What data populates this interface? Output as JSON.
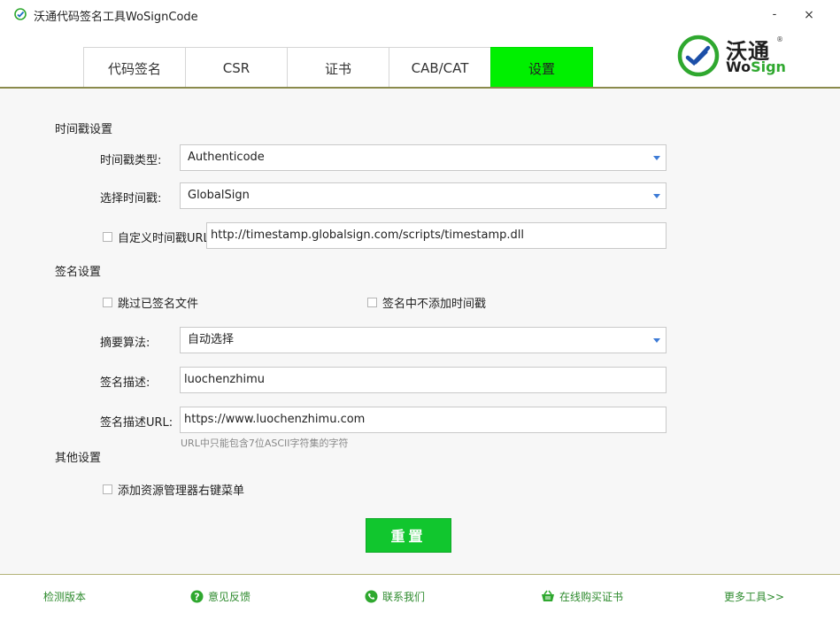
{
  "window": {
    "title": "沃通代码签名工具WoSignCode",
    "minimize_label": "-",
    "close_label": "×"
  },
  "tabs": [
    {
      "label": "代码签名",
      "active": false
    },
    {
      "label": "CSR",
      "active": false
    },
    {
      "label": "证书",
      "active": false
    },
    {
      "label": "CAB/CAT",
      "active": false
    },
    {
      "label": "设置",
      "active": true
    }
  ],
  "logo": {
    "cn": "沃通",
    "en_prefix": "Wo",
    "en_suffix": "Sign",
    "reg": "®"
  },
  "timestamp_settings": {
    "section_title": "时间戳设置",
    "type_label": "时间戳类型:",
    "type_value": "Authenticode",
    "select_label": "选择时间戳:",
    "select_value": "GlobalSign",
    "custom_url_label": "自定义时间戳URL",
    "custom_url_checked": false,
    "custom_url_value": "http://timestamp.globalsign.com/scripts/timestamp.dll"
  },
  "sign_settings": {
    "section_title": "签名设置",
    "skip_signed_label": "跳过已签名文件",
    "skip_signed_checked": false,
    "no_timestamp_label": "签名中不添加时间戳",
    "no_timestamp_checked": false,
    "digest_label": "摘要算法:",
    "digest_value": "自动选择",
    "desc_label": "签名描述:",
    "desc_value": "luochenzhimu",
    "desc_url_label": "签名描述URL:",
    "desc_url_value": "https://www.luochenzhimu.com",
    "desc_url_hint": "URL中只能包含7位ASCII字符集的字符"
  },
  "other_settings": {
    "section_title": "其他设置",
    "context_menu_label": "添加资源管理器右键菜单",
    "context_menu_checked": false
  },
  "reset_label": "重置",
  "footer": {
    "check_version": "检测版本",
    "feedback": "意见反馈",
    "contact": "联系我们",
    "buy_cert": "在线购买证书",
    "more_tools": "更多工具>>"
  },
  "colors": {
    "active_tab": "#00f000",
    "reset_button": "#11c62e",
    "footer_link": "#2e8b2e",
    "brand_green": "#2fa82f"
  },
  "icons": {
    "app": "wosign-check-icon",
    "feedback": "question-circle-icon",
    "contact": "phone-icon",
    "buy": "basket-icon"
  }
}
